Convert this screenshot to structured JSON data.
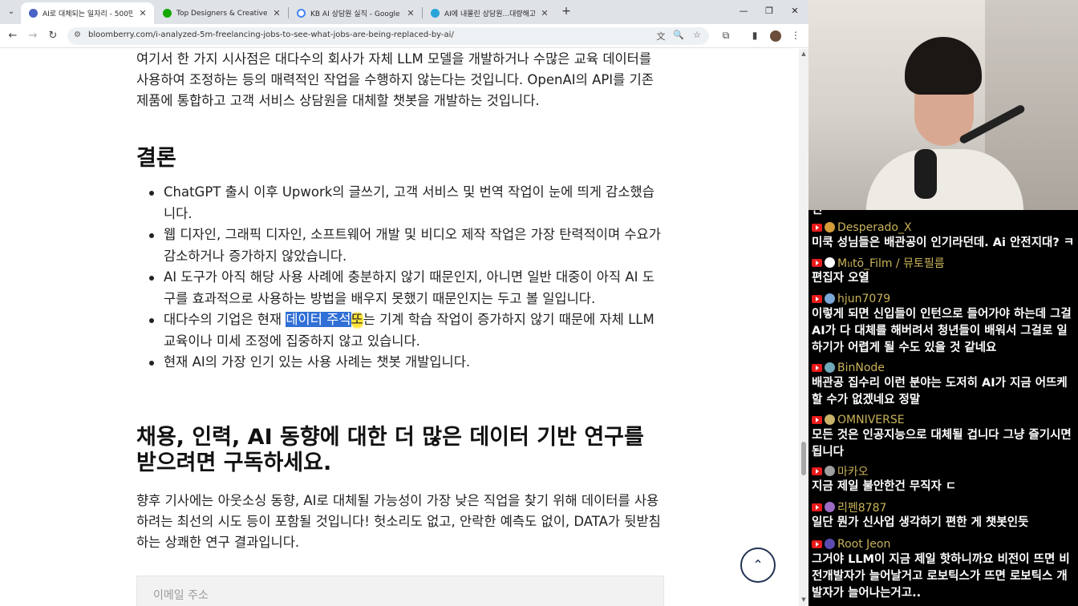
{
  "browser": {
    "tabs": [
      {
        "title": "AI로 대체되는 일자리 - 500만",
        "active": true,
        "favicon_color": "#4a63c7"
      },
      {
        "title": "Top Designers & Creatives for",
        "active": false,
        "favicon_color": "#14a800"
      },
      {
        "title": "KB AI 상담원 실직 - Google 검",
        "active": false,
        "favicon_color": "#4285f4"
      },
      {
        "title": "AI에 내몰린 상담원...대량해고",
        "active": false,
        "favicon_color": "#2aa3d8"
      }
    ],
    "new_tab_label": "+",
    "tab_close": "✕",
    "window_controls": {
      "minimize": "—",
      "restore": "❐",
      "close": "✕"
    },
    "url": "bloomberry.com/i-analyzed-5m-freelancing-jobs-to-see-what-jobs-are-being-replaced-by-ai/",
    "icons": {
      "back": "←",
      "forward": "→",
      "reload": "↻",
      "site_info": "⚙",
      "translate": "文",
      "zoom": "🔍",
      "bookmark": "☆",
      "extensions": "⧉",
      "sidebar": "▮",
      "menu": "⋮",
      "tab_list": "⌄"
    }
  },
  "article": {
    "intro": "여기서 한 가지 시사점은 대다수의 회사가 자체 LLM 모델을 개발하거나 수많은 교육 데이터를 사용하여 조정하는 등의 매력적인 작업을 수행하지 않는다는 것입니다. OpenAI의 API를 기존 제품에 통합하고 고객 서비스 상담원을 대체할 챗봇을 개발하는 것입니다.",
    "conclusion_heading": "결론",
    "bullets": [
      "ChatGPT 출시 이후 Upwork의 글쓰기, 고객 서비스 및 번역 작업이 눈에 띄게 감소했습니다.",
      "웹 디자인, 그래픽 디자인, 소프트웨어 개발 및 비디오 제작 작업은 가장 탄력적이며 수요가 감소하거나 증가하지 않았습니다.",
      "AI 도구가 아직 해당 사용 사례에 충분하지 않기 때문인지, 아니면 일반 대중이 아직 AI 도구를 효과적으로 사용하는 방법을 배우지 못했기 때문인지는 두고 볼 일입니다."
    ],
    "bullet4": {
      "before": "대다수의 기업은 현재 ",
      "highlight": "데이터 주석",
      "cursor_char": "또",
      "after": "는 기계 학습 작업이 증가하지 않기 때문에 자체 LLM 교육이나 미세 조정에 집중하지 않고 있습니다."
    },
    "bullet5": "현재 AI의 가장 인기 있는 사용 사례는 챗봇 개발입니다.",
    "subscribe_heading": "채용, 인력, AI 동향에 대한 더 많은 데이터 기반 연구를 받으려면 구독하세요.",
    "subscribe_text": "향후 기사에는 아웃소싱 동향, AI로 대체될 가능성이 가장 낮은 직업을 찾기 위해 데이터를 사용하려는 최선의 시도 등이 포함될 것입니다! 헛소리도 없고, 안락한 예측도 없이, DATA가 뒷받침하는 상쾌한 연구 결과입니다.",
    "email_placeholder": "이메일 주소",
    "scroll_top_icon": "⌃"
  },
  "chat": {
    "partial_top": "긴",
    "messages": [
      {
        "user": "Desperado_X",
        "text": "미쿡 성님들은 배관공이 인기라던데. Ai 안전지대? ㅋ",
        "avatar_color": "#d39b3a"
      },
      {
        "user": "M𝔲tō_Film / 뮤토필름",
        "text": "편집자 오열",
        "avatar_color": "#ffffff"
      },
      {
        "user": "hjun7079",
        "text": "이렇게 되면 신입들이 인턴으로 들어가야 하는데 그걸 AI가 다 대체를 해버려서 청년들이 배워서 그걸로 일하기가 어렵게 될 수도 있을 것 같네요",
        "avatar_color": "#7aa7d6"
      },
      {
        "user": "BinNode",
        "text": "배관공 집수리 이런 분야는 도저히 AI가 지금 어뜨케 할 수가 없겠네요 정말",
        "avatar_color": "#6fa8b8"
      },
      {
        "user": "OMNIVERSE",
        "text": "모든 것은 인공지능으로 대체될 겁니다 그냥 즐기시면 됩니다",
        "avatar_color": "#c8b26a"
      },
      {
        "user": "마카오",
        "text": "지금 제일 불안한건 무직자 ㄷ",
        "avatar_color": "#9e9e9e"
      },
      {
        "user": "리펜8787",
        "text": "일단 뭔가 신사업 생각하기 편한 게 챗봇인듯",
        "avatar_color": "#9c6bc4"
      },
      {
        "user": "Root Jeon",
        "text": "그거야 LLM이 지금 제일 핫하니까요 비전이 뜨면 비전개발자가 늘어날거고 로보틱스가 뜨면 로보틱스 개발자가 늘어나는거고..",
        "avatar_color": "#5b4bb0"
      }
    ]
  }
}
